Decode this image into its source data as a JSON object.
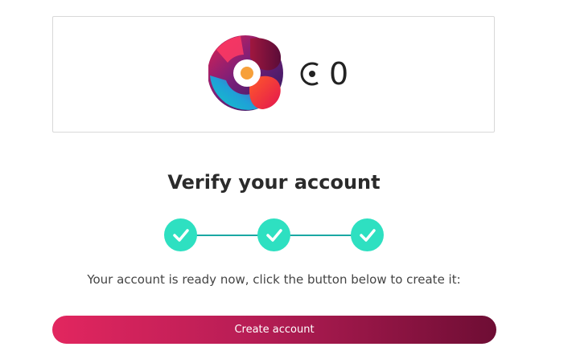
{
  "header": {
    "logo_icon": "brand-c-logo-icon",
    "currency_icon": "coin-c-icon",
    "balance": "0"
  },
  "verify": {
    "title": "Verify your account",
    "steps": [
      {
        "status": "complete",
        "icon": "check-icon"
      },
      {
        "status": "complete",
        "icon": "check-icon"
      },
      {
        "status": "complete",
        "icon": "check-icon"
      }
    ],
    "message": "Your account is ready now, click the button below to create it:",
    "button_label": "Create account"
  },
  "colors": {
    "step_fill": "#2ee0c1",
    "step_line": "#1aa8a3",
    "button_start": "#e2265f",
    "button_end": "#6e0d34"
  }
}
